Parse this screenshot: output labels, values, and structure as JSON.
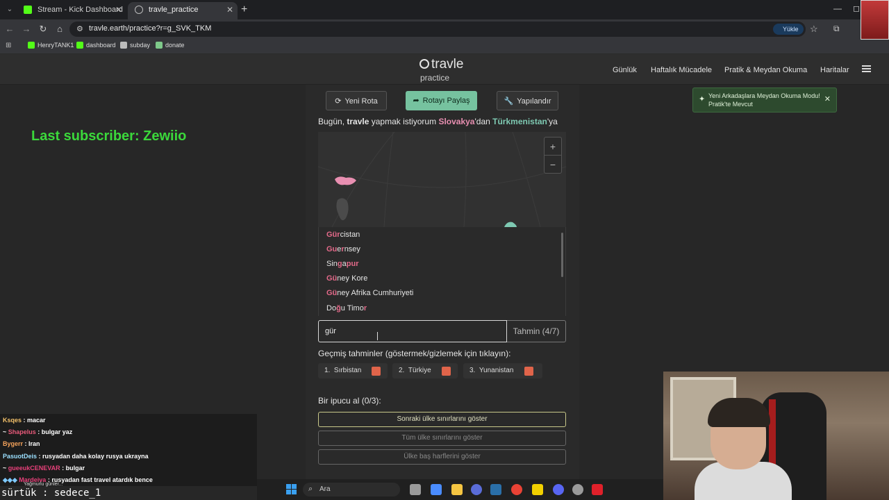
{
  "browser": {
    "tabs": [
      {
        "label": "Stream - Kick Dashboard"
      },
      {
        "label": "travle_practice"
      }
    ],
    "url": "travle.earth/practice?r=g_SVK_TKM",
    "load_button": "Yükle",
    "bookmarks": [
      "HenryTANK1",
      "dashboard",
      "subday",
      "donate"
    ]
  },
  "site": {
    "logo": "travle",
    "subtitle": "practice",
    "nav": [
      "Günlük",
      "Haftalık Mücadele",
      "Pratik & Meydan Okuma",
      "Haritalar"
    ]
  },
  "toast": {
    "text": "Yeni Arkadaşlara Meydan Okuma Modu! Pratik'te Mevcut"
  },
  "overlay": {
    "last_subscriber": "Last subscriber: Zewiio"
  },
  "actions": {
    "new_route": "Yeni Rota",
    "share_route": "Rotayı Paylaş",
    "configure": "Yapılandır"
  },
  "prompt": {
    "pre": "Bugün, ",
    "brand": "travle",
    "mid1": " yapmak istiyorum ",
    "from": "Slovakya",
    "mid2": "'dan ",
    "to": "Türkmenistan",
    "post": "'ya"
  },
  "colors": {
    "start_country": "#e88fb1",
    "end_country": "#7ec9b2",
    "wrong_guess": "#e0644a",
    "accent_button": "#76c29f"
  },
  "suggestions": [
    {
      "hl": "Gür",
      "rest": "cistan"
    },
    {
      "hl": "Gu",
      "mid": "e",
      "hl2": "r",
      "rest": "nsey"
    },
    {
      "pre": "Sin",
      "hl": "g",
      "mid": "a",
      "hl2": "pur"
    },
    {
      "hl": "Gü",
      "rest": "ney Kore"
    },
    {
      "hl": "Gü",
      "rest": "ney Afrika Cumhuriyeti"
    },
    {
      "pre": "Do",
      "hl": "ğ",
      "mid": "u Timo",
      "hl2": "r"
    }
  ],
  "guess": {
    "value": "gür",
    "button": "Tahmin (4/7)"
  },
  "past_guesses": {
    "title": "Geçmiş tahminler (göstermek/gizlemek için tıklayın):",
    "items": [
      {
        "num": "1.",
        "name": "Sırbistan"
      },
      {
        "num": "2.",
        "name": "Türkiye"
      },
      {
        "num": "3.",
        "name": "Yunanistan"
      }
    ]
  },
  "hints": {
    "title": "Bir ipucu al (0/3):",
    "buttons": [
      "Sonraki ülke sınırlarını göster",
      "Tüm ülke sınırlarını göster",
      "Ülke baş harflerini göster"
    ]
  },
  "chat": [
    {
      "user": "Ksqes",
      "color": "#f5c26b",
      "msg": "macar"
    },
    {
      "user": "Shapelus",
      "color": "#e85a7a",
      "msg": "bulgar yaz"
    },
    {
      "user": "Bygerr",
      "color": "#f5a35b",
      "msg": "Iran"
    },
    {
      "user": "PasuotDeis",
      "color": "#9be0ff",
      "msg": "rusyadan daha kolay rusya ukrayna"
    },
    {
      "user": "gueeukCENEVAR",
      "color": "#e8407a",
      "msg": "bulgar"
    },
    {
      "user": "Mardeiva",
      "color": "#e8407a",
      "msg": "rusyadan fast travel atardık bence"
    }
  ],
  "chat_sub": "Yağmurlu günler...",
  "stream_text": "sürtük : sedece_1",
  "taskbar": {
    "search": "Ara"
  }
}
